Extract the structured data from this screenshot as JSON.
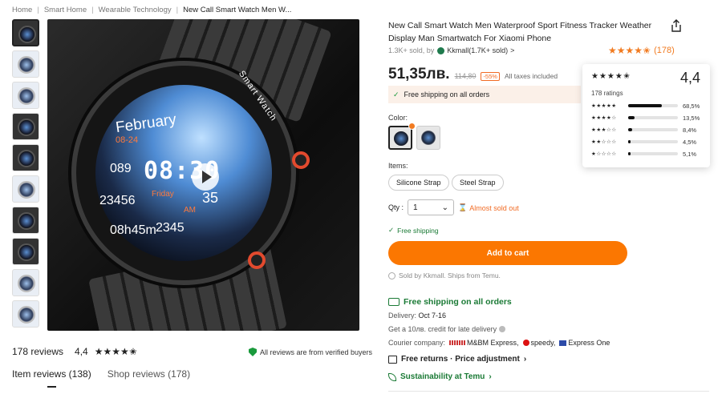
{
  "breadcrumb": [
    "Home",
    "Smart Home",
    "Wearable Technology",
    "New Call Smart Watch Men W..."
  ],
  "hero": {
    "date": "February",
    "date_sub": "08-24",
    "time": "08:30",
    "seconds": "35",
    "day": "Friday",
    "ampm": "AM",
    "heart": "089",
    "steps": "23456",
    "fire": "2345",
    "sleep": "08h45m",
    "ring": "Smart Watch"
  },
  "reviews": {
    "count_label": "178 reviews",
    "avg": "4,4",
    "verified": "All reviews are from verified buyers",
    "tab_item": "Item reviews (138)",
    "tab_shop": "Shop reviews (178)"
  },
  "product": {
    "title": "New Call Smart Watch Men Waterproof Sport Fitness Tracker Weather Display Man Smartwatch For Xiaomi Phone",
    "sold": "1.3K+ sold, by",
    "store": "Kkmall(1.7K+ sold)",
    "store_chevron": ">",
    "rating_count": "(178)",
    "price": "51,35лв.",
    "old_price": "114,80",
    "discount": "-55%",
    "taxes": "All taxes included",
    "ship_banner": "Free shipping on all orders",
    "color_label": "Color:",
    "items_label": "Items:",
    "items": [
      "Silicone Strap",
      "Steel Strap"
    ],
    "qty_label": "Qty :",
    "qty_value": "1",
    "almost_sold": "Almost sold out",
    "free_ship_small": "Free shipping",
    "add_to_cart": "Add to cart",
    "sold_by": "Sold by Kkmall. Ships from Temu."
  },
  "shipping": {
    "free_all": "Free shipping on all orders",
    "delivery_label": "Delivery:",
    "delivery_date": "Oct 7-16",
    "credit": "Get a 10лв. credit for late delivery",
    "courier_label": "Courier company:",
    "couriers": [
      "M&BM Express,",
      "speedy,",
      "Express One"
    ],
    "returns": "Free returns · Price adjustment",
    "sustain": "Sustainability at Temu"
  },
  "rating_popover": {
    "avg": "4,4",
    "count": "178 ratings",
    "rows": [
      {
        "stars": "★★★★★",
        "pct": "68,5%",
        "fraction": 0.685
      },
      {
        "stars": "★★★★☆",
        "pct": "13,5%",
        "fraction": 0.135
      },
      {
        "stars": "★★★☆☆",
        "pct": "8,4%",
        "fraction": 0.084
      },
      {
        "stars": "★★☆☆☆",
        "pct": "4,5%",
        "fraction": 0.045
      },
      {
        "stars": "★☆☆☆☆",
        "pct": "5,1%",
        "fraction": 0.051
      }
    ]
  },
  "colors": {
    "accent": "#fb7701",
    "green": "#1a7a35",
    "star": "#f17b21"
  }
}
